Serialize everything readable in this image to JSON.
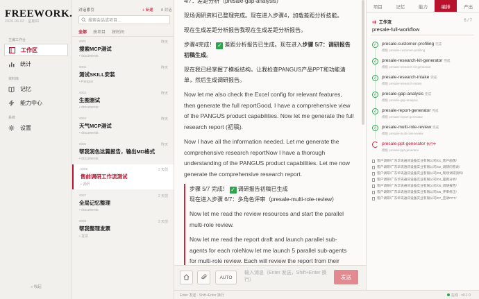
{
  "app": {
    "logo": "FREEWORK.",
    "date": "2026.06.02 · 星期四"
  },
  "nav": {
    "section_workspace": "主编工作台",
    "item_workspace": "工作区",
    "item_stats": "统计",
    "section_library": "资料库",
    "item_memory": "记忆",
    "item_skills": "能力中心",
    "section_system": "系统",
    "item_settings": "设置",
    "collapse": "« 收起"
  },
  "conversations": {
    "heading": "对话索引",
    "new": "+ 新建",
    "count": "8 对话",
    "search_placeholder": "搜索会话或项目…",
    "filters": [
      "全部",
      "按项目",
      "按时间"
    ],
    "items": [
      {
        "id": "0001",
        "title": "搜索MCP测试",
        "tag": "documents",
        "when": "昨天"
      },
      {
        "id": "0002",
        "title": "测试SKILL安装",
        "tag": "Pangus",
        "when": "昨天"
      },
      {
        "id": "0003",
        "title": "生图测试",
        "tag": "documents",
        "when": "昨天"
      },
      {
        "id": "0004",
        "title": "天气MCP测试",
        "tag": "documents",
        "when": "昨天"
      },
      {
        "id": "0005",
        "title": "帮我润色这篇报告，输出MD格式",
        "tag": "documents",
        "when": "昨天"
      },
      {
        "id": "0006",
        "title": "售前调研工作流测试",
        "tag": "调研",
        "when": "2 天前"
      },
      {
        "id": "0007",
        "title": "全局记忆整理",
        "tag": "documents",
        "when": "2 天前"
      },
      {
        "id": "0008",
        "title": "帮我整理发票",
        "tag": "发票",
        "when": "2 天前"
      }
    ]
  },
  "chat": {
    "p1": "4/7：差距分析（presale-gap-analysis）",
    "p2": "现场调研资料已整理完成。现在进入步骤4，加载差距分析技能。",
    "p3": "现在生成差距分析报告我现在生成差距分析报告。",
    "p4a": "步骤4完成！",
    "p4b": "差距分析报告已生成。现在进入",
    "p4c": "步骤 5/7：调研报告初稿生成",
    "p4d": "。",
    "p5": "现在我已经掌握了模板结构。让我检查PANGUS产品PPT和功能清单，然后生成调研报告。",
    "p6": "Now let me also check the Excel config for relevant features, then generate the full reportGood, I have a comprehensive view of the PANGUS product capabilities. Now let me generate the full research report (初稿).",
    "p7": "Now I have all the information needed. Let me generate the comprehensive research reportNow I have a thorough understanding of the PANGUS product capabilities. Let me now generate the comprehensive research report.",
    "q1a": "步骤 5/7 完成！",
    "q1b": "调研报告初稿已生成",
    "q2": "现在进入步骤 6/7：多角色评审（presale-multi-role-review）",
    "q3": "Now let me read the review resources and start the parallel multi-role review.",
    "q4": "Now let me read the report draft and launch parallel sub-agents for each roleNow let me launch 5 parallel sub-agents for multi-role review. Each will review the report from their perspective."
  },
  "composer": {
    "auto_label": "AUTO",
    "placeholder": "输入消息（Enter 发送，Shift+Enter 换行）",
    "send": "发送"
  },
  "footer": {
    "hint": "Enter 发送 · Shift+Enter 换行",
    "status": "在线 · v0.1.0"
  },
  "right": {
    "tabs": [
      "项目",
      "记忆",
      "能力",
      "编排",
      "产出"
    ],
    "workflow_heading": "工作流",
    "workflow_count": "6 / 7",
    "workflow_name": "presale-full-workflow",
    "steps": [
      {
        "name": "presale-customer-profiling",
        "status": "完成",
        "agent": "模板 presale-customer-profiling"
      },
      {
        "name": "presale-research-kit-generator",
        "status": "完成",
        "agent": "模板 presale-research-kit-generator"
      },
      {
        "name": "presale-research-intake",
        "status": "完成",
        "agent": "模板 presale-research-intake"
      },
      {
        "name": "presale-gap-analysis",
        "status": "完成",
        "agent": "模板 presale-gap-analysis"
      },
      {
        "name": "presale-report-generator",
        "status": "完成",
        "agent": "模板 presale-report-generator"
      },
      {
        "name": "presale-multi-role-review",
        "status": "完成",
        "agent": "模板 presale-multi-role-review"
      },
      {
        "name": "presale-ppt-generator",
        "status": "执行中",
        "agent": "模板 presale-ppt-generator"
      }
    ],
    "files": [
      "客户调研/广东华讯通讯设备实业有限公司/01_客户画像/",
      "客户调研/广东华讯通讯设备实业有限公司/02_调研问卷表/",
      "客户调研/广东华讯通讯设备实业有限公司/03_现场调研资料/",
      "客户调研/广东华讯通讯设备实业有限公司/04_差距分析/",
      "客户调研/广东华讯通讯设备实业有限公司/05_调研报告/",
      "客户调研/广东华讯通讯设备实业有限公司/06_评审修正/",
      "客户调研/广东华讯通讯设备实业有限公司/07_宣讲PPT/"
    ]
  },
  "colors": {
    "accent": "#b8132d",
    "success": "#2ea44f"
  }
}
